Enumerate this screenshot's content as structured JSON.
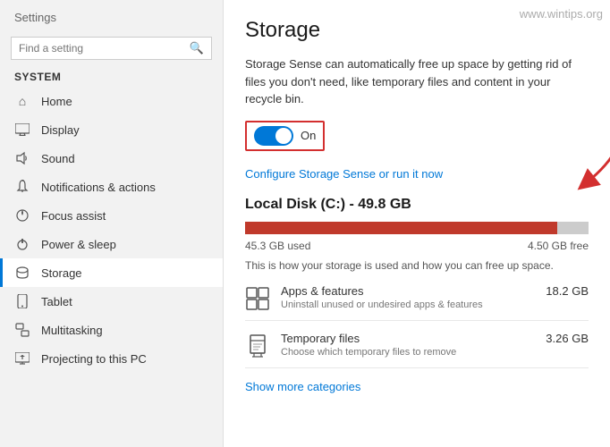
{
  "app": {
    "title": "Settings",
    "watermark": "www.wintips.org"
  },
  "sidebar": {
    "search_placeholder": "Find a setting",
    "system_label": "System",
    "nav_items": [
      {
        "id": "home",
        "label": "Home",
        "icon": "⌂"
      },
      {
        "id": "display",
        "label": "Display",
        "icon": "🖥"
      },
      {
        "id": "sound",
        "label": "Sound",
        "icon": "🔊"
      },
      {
        "id": "notifications",
        "label": "Notifications & actions",
        "icon": "🔔"
      },
      {
        "id": "focus",
        "label": "Focus assist",
        "icon": "🌙"
      },
      {
        "id": "power",
        "label": "Power & sleep",
        "icon": "⏻"
      },
      {
        "id": "storage",
        "label": "Storage",
        "icon": "💾",
        "active": true
      },
      {
        "id": "tablet",
        "label": "Tablet",
        "icon": "📱"
      },
      {
        "id": "multitasking",
        "label": "Multitasking",
        "icon": "⧉"
      },
      {
        "id": "projecting",
        "label": "Projecting to this PC",
        "icon": "📺"
      }
    ]
  },
  "main": {
    "page_title": "Storage",
    "description": "Storage Sense can automatically free up space by getting rid of files you don't need, like temporary files and content in your recycle bin.",
    "toggle_state": "On",
    "config_link": "Configure Storage Sense or run it now",
    "local_disk": {
      "title": "Local Disk (C:) - 49.8 GB",
      "used_gb": "45.3 GB used",
      "free_gb": "4.50 GB free",
      "used_percent": 91,
      "description": "This is how your storage is used and how you can free up space."
    },
    "storage_items": [
      {
        "title": "Apps & features",
        "subtitle": "Uninstall unused or undesired apps & features",
        "size": "18.2 GB"
      },
      {
        "title": "Temporary files",
        "subtitle": "Choose which temporary files to remove",
        "size": "3.26 GB"
      }
    ],
    "show_more": "Show more categories"
  }
}
